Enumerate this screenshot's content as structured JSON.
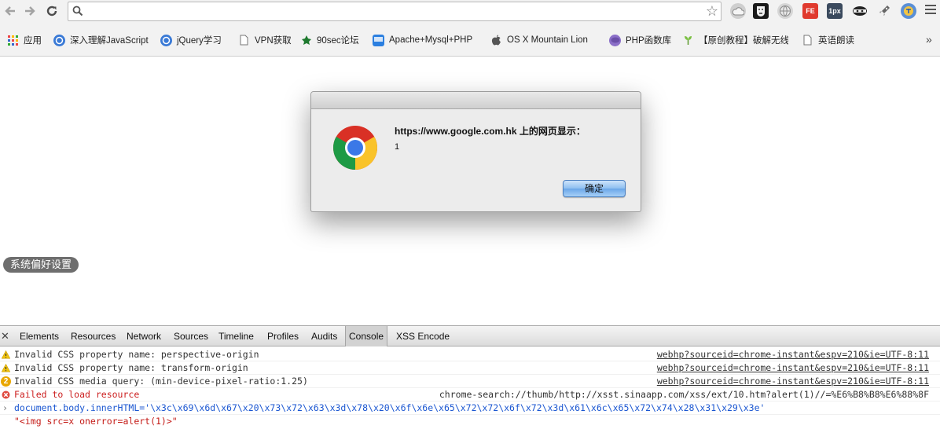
{
  "colors": {
    "toolbar_bg": "#f2f2f2",
    "pill_bg": "#6e6e6e",
    "error_red": "#cc1f1f",
    "command_blue": "#1a56d1",
    "ok_button_blue": "#8dbef0"
  },
  "toolbar": {
    "back_icon": "arrow-left-icon",
    "forward_icon": "arrow-right-icon",
    "reload_icon": "reload-icon",
    "omnibox_value": "",
    "extensions": [
      "cloud-icon",
      "anonymous-mask-icon",
      "globe-icon",
      "FE",
      "1px",
      "ninja-icon",
      "rocket-icon",
      "translate-icon"
    ]
  },
  "bookmarks": [
    {
      "label": "应用",
      "icon": "apps-grid-icon"
    },
    {
      "label": "深入理解JavaScript",
      "icon": "blog-icon"
    },
    {
      "label": "jQuery学习",
      "icon": "blog-icon"
    },
    {
      "label": "VPN获取",
      "icon": "page-icon"
    },
    {
      "label": "90sec论坛",
      "icon": "leaf-icon"
    },
    {
      "label": "Apache+Mysql+PHP",
      "icon": "mac-icon"
    },
    {
      "label": "OS X Mountain Lion",
      "icon": "apple-icon"
    },
    {
      "label": "PHP函数库",
      "icon": "php-icon"
    },
    {
      "label": "【原创教程】破解无线",
      "icon": "sprout-icon"
    },
    {
      "label": "英语朗读",
      "icon": "page-icon"
    }
  ],
  "content": {
    "pref_button": "系统偏好设置"
  },
  "dialog": {
    "title": "https://www.google.com.hk 上的网页显示：",
    "message": "1",
    "ok_label": "确定"
  },
  "devtools": {
    "tabs": [
      "Elements",
      "Resources",
      "Network",
      "Sources",
      "Timeline",
      "Profiles",
      "Audits",
      "Console",
      "XSS Encode"
    ],
    "active_tab": "Console",
    "console": [
      {
        "level": "warning",
        "message": "Invalid CSS property name: perspective-origin",
        "source": "webhp?sourceid=chrome-instant&espv=210&ie=UTF-8:11"
      },
      {
        "level": "warning",
        "message": "Invalid CSS property name: transform-origin",
        "source": "webhp?sourceid=chrome-instant&espv=210&ie=UTF-8:11"
      },
      {
        "level": "warning",
        "message": "Invalid CSS media query: (min-device-pixel-ratio:1.25)",
        "source": "webhp?sourceid=chrome-instant&espv=210&ie=UTF-8:11",
        "count": "2"
      },
      {
        "level": "error",
        "message": "Failed to load resource",
        "source": "chrome-search://thumb/http://xsst.sinaapp.com/xss/ext/10.htm?alert(1)//=%E6%B8%B8%E6%88%8F"
      },
      {
        "level": "command",
        "message": "document.body.innerHTML='\\x3c\\x69\\x6d\\x67\\x20\\x73\\x72\\x63\\x3d\\x78\\x20\\x6f\\x6e\\x65\\x72\\x72\\x6f\\x72\\x3d\\x61\\x6c\\x65\\x72\\x74\\x28\\x31\\x29\\x3e'"
      },
      {
        "level": "result",
        "message": "\"<img src=x onerror=alert(1)>\""
      }
    ]
  }
}
